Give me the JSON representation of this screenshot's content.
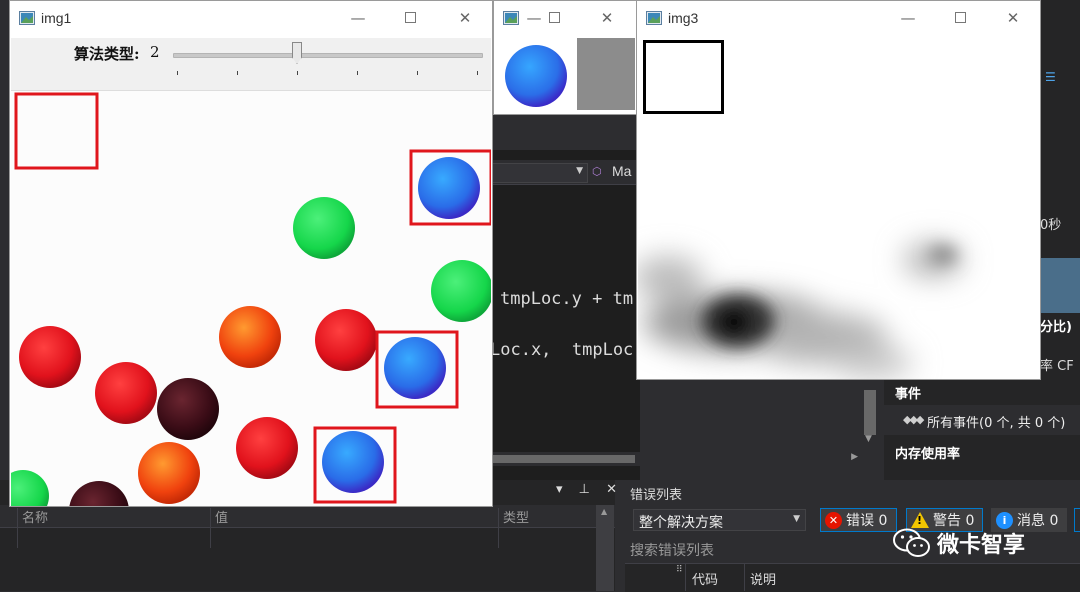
{
  "windows": {
    "img1": {
      "title": "img1",
      "trackbar": {
        "label": "算法类型:",
        "value": "2",
        "level_fraction": 0.5,
        "tick_count": 6
      },
      "template_matches_count": 3
    },
    "img2": {
      "title": ""
    },
    "img3": {
      "title": "img3"
    }
  },
  "editor": {
    "member_combo": "",
    "member_combo2": "Ma",
    "code_lines": [
      "tmpLoc.y + tm",
      "Loc.x,  tmpLoc."
    ]
  },
  "diagnostics": {
    "time_label": "0秒",
    "cpu_title": "分比)",
    "rate_label": "率   CF",
    "events_title": "事件",
    "events_all": "所有事件(0 个, 共 0 个)",
    "memory_title": "内存使用率"
  },
  "locals": {
    "columns": [
      "名称",
      "值",
      "类型"
    ],
    "tools": "▾ ⊥ ✕"
  },
  "error_list": {
    "title": "错误列表",
    "scope": "整个解决方案",
    "errors_label": "错误 0",
    "warnings_label": "警告 0",
    "messages_label": "消息 0",
    "search_placeholder": "搜索错误列表",
    "col_code": "代码",
    "col_desc": "说明"
  },
  "watermark": {
    "text": "微卡智享"
  },
  "colors": {
    "match_box": "#e0161c",
    "vs_background": "#2d2d30",
    "vs_accent": "#007acc"
  }
}
